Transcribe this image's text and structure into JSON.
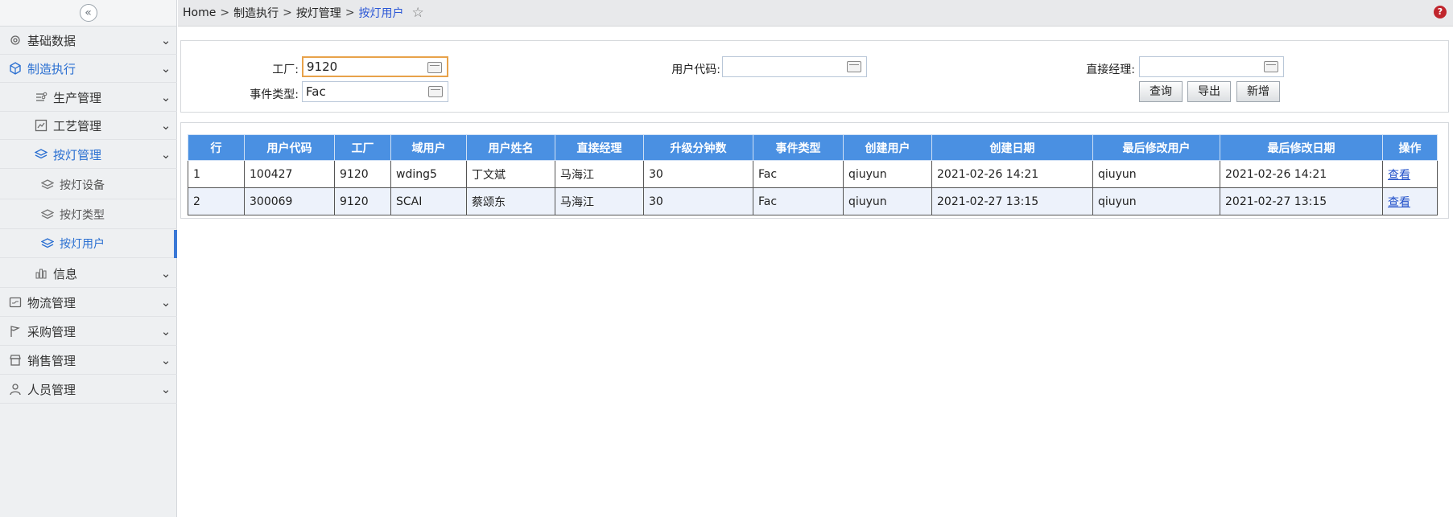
{
  "sidebar": {
    "collapse_glyph": "«",
    "items": [
      {
        "label": "基础数据",
        "icon": "gear-icon"
      },
      {
        "label": "制造执行",
        "icon": "cube-icon"
      },
      {
        "label": "生产管理",
        "icon": "process-icon"
      },
      {
        "label": "工艺管理",
        "icon": "document-chart-icon"
      },
      {
        "label": "按灯管理",
        "icon": "layers-icon"
      },
      {
        "label": "按灯设备",
        "icon": "layers-icon"
      },
      {
        "label": "按灯类型",
        "icon": "layers-icon"
      },
      {
        "label": "按灯用户",
        "icon": "layers-icon"
      },
      {
        "label": "信息",
        "icon": "bar-chart-icon"
      },
      {
        "label": "物流管理",
        "icon": "truck-icon"
      },
      {
        "label": "采购管理",
        "icon": "flag-icon"
      },
      {
        "label": "销售管理",
        "icon": "store-icon"
      },
      {
        "label": "人员管理",
        "icon": "person-icon"
      }
    ]
  },
  "breadcrumb": {
    "items": [
      "Home",
      "制造执行",
      "按灯管理",
      "按灯用户"
    ],
    "separator": ">"
  },
  "help_glyph": "?",
  "filter": {
    "factory_label": "工厂:",
    "factory_value": "9120",
    "user_code_label": "用户代码:",
    "user_code_value": "",
    "manager_label": "直接经理:",
    "manager_value": "",
    "event_type_label": "事件类型:",
    "event_type_value": "Fac",
    "query_button": "查询",
    "export_button": "导出",
    "add_button": "新增"
  },
  "table": {
    "columns": [
      "行",
      "用户代码",
      "工厂",
      "域用户",
      "用户姓名",
      "直接经理",
      "升级分钟数",
      "事件类型",
      "创建用户",
      "创建日期",
      "最后修改用户",
      "最后修改日期",
      "操作"
    ],
    "rows": [
      [
        "1",
        "100427",
        "9120",
        "wding5",
        "丁文斌",
        "马海江",
        "30",
        "Fac",
        "qiuyun",
        "2021-02-26 14:21",
        "qiuyun",
        "2021-02-26 14:21",
        "查看"
      ],
      [
        "2",
        "300069",
        "9120",
        "SCAI",
        "蔡颂东",
        "马海江",
        "30",
        "Fac",
        "qiuyun",
        "2021-02-27 13:15",
        "qiuyun",
        "2021-02-27 13:15",
        "查看"
      ]
    ]
  },
  "colors": {
    "accent": "#2a6fd1",
    "header_blue": "#4a90e2",
    "focus_orange": "#e8a24a"
  }
}
